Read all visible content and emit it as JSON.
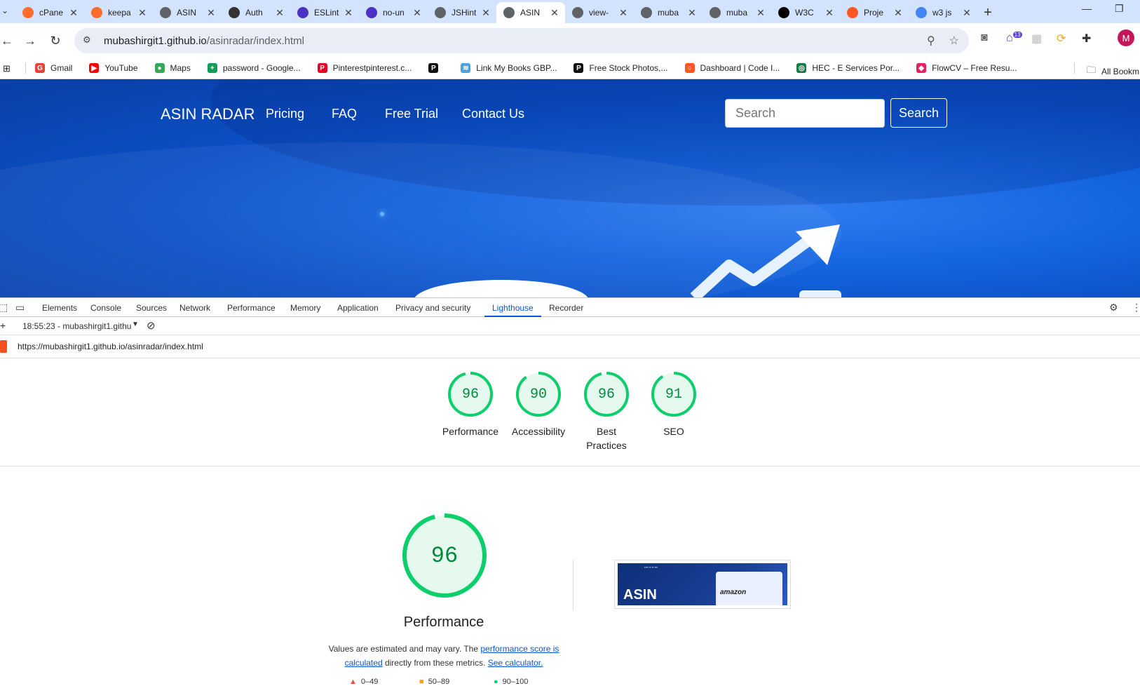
{
  "browser": {
    "tabs": [
      {
        "title": "cPane",
        "favicon_color": "#ff6c2c",
        "favicon": "cP"
      },
      {
        "title": "keepa",
        "favicon_color": "#ff6c2c",
        "favicon": "cP"
      },
      {
        "title": "ASIN",
        "favicon_color": "#5f6368",
        "favicon": "globe"
      },
      {
        "title": "Auth",
        "favicon_color": "#333333",
        "favicon": "openai"
      },
      {
        "title": "ESLint",
        "favicon_color": "#4b32c3",
        "favicon": "eslint"
      },
      {
        "title": "no-un",
        "favicon_color": "#4b32c3",
        "favicon": "eslint"
      },
      {
        "title": "JSHint",
        "favicon_color": "#5f6368",
        "favicon": "globe"
      },
      {
        "title": "ASIN",
        "favicon_color": "#5f6368",
        "favicon": "globe",
        "active": true
      },
      {
        "title": "view-",
        "favicon_color": "#5f6368",
        "favicon": "globe"
      },
      {
        "title": "muba",
        "favicon_color": "#5f6368",
        "favicon": "globe"
      },
      {
        "title": "muba",
        "favicon_color": "#5f6368",
        "favicon": "globe"
      },
      {
        "title": "W3C",
        "favicon_color": "#000000",
        "favicon": "w3c"
      },
      {
        "title": "Proje",
        "favicon_color": "#ff5722",
        "favicon": "circle"
      },
      {
        "title": "w3 js",
        "favicon_color": "#4285f4",
        "favicon": "G"
      }
    ],
    "url_host": "mubashirgit1.github.io",
    "url_path": "/asinradar/index.html",
    "extension_badge": "13",
    "avatar_letter": "M",
    "bookmarks": [
      {
        "label": "Gmail",
        "color": "#ea4335",
        "glyph": "G"
      },
      {
        "label": "YouTube",
        "color": "#ff0000",
        "glyph": "▶"
      },
      {
        "label": "Maps",
        "color": "#34a853",
        "glyph": "●"
      },
      {
        "label": "password - Google...",
        "color": "#0f9d58",
        "glyph": "+"
      },
      {
        "label": "Pinterestpinterest.c...",
        "color": "#e60023",
        "glyph": "P"
      },
      {
        "label": "",
        "color": "#111111",
        "glyph": "P"
      },
      {
        "label": "Link My Books GBP...",
        "color": "#4aa3df",
        "glyph": "≋"
      },
      {
        "label": "Free Stock Photos,...",
        "color": "#111111",
        "glyph": "P"
      },
      {
        "label": "Dashboard | Code I...",
        "color": "#ff5722",
        "glyph": "○"
      },
      {
        "label": "HEC - E Services Por...",
        "color": "#1b7a4a",
        "glyph": "◎"
      },
      {
        "label": "FlowCV – Free Resu...",
        "color": "#e91e63",
        "glyph": "◆"
      }
    ],
    "all_bookmarks": "All Bookm"
  },
  "site": {
    "brand": "ASIN RADAR",
    "nav": [
      "Pricing",
      "FAQ",
      "Free Trial",
      "Contact Us"
    ],
    "search_placeholder": "Search",
    "search_button": "Search"
  },
  "devtools": {
    "tabs": [
      "Elements",
      "Console",
      "Sources",
      "Network",
      "Performance",
      "Memory",
      "Application",
      "Privacy and security",
      "Lighthouse",
      "Recorder"
    ],
    "active_tab": "Lighthouse",
    "report_select": "18:55:23 - mubashirgit1.githu",
    "report_url": "https://mubashirgit1.github.io/asinradar/index.html"
  },
  "lighthouse": {
    "scores": [
      {
        "label": "Performance",
        "value": 96
      },
      {
        "label": "Accessibility",
        "value": 90
      },
      {
        "label": "Best Practices",
        "value": 96
      },
      {
        "label": "SEO",
        "value": 91
      }
    ],
    "performance_title": "Performance",
    "performance_value": 96,
    "note_prefix": "Values are estimated and may vary. The",
    "note_link1": "performance score is calculated",
    "note_middle": "directly from these metrics.",
    "note_link2": "See calculator.",
    "legend": [
      "0–49",
      "50–89",
      "90–100"
    ],
    "score_color": "#0cce6b",
    "score_bg": "#e6f9ee"
  },
  "thumbnail": {
    "title": "ASIN",
    "badge": "amazon"
  }
}
